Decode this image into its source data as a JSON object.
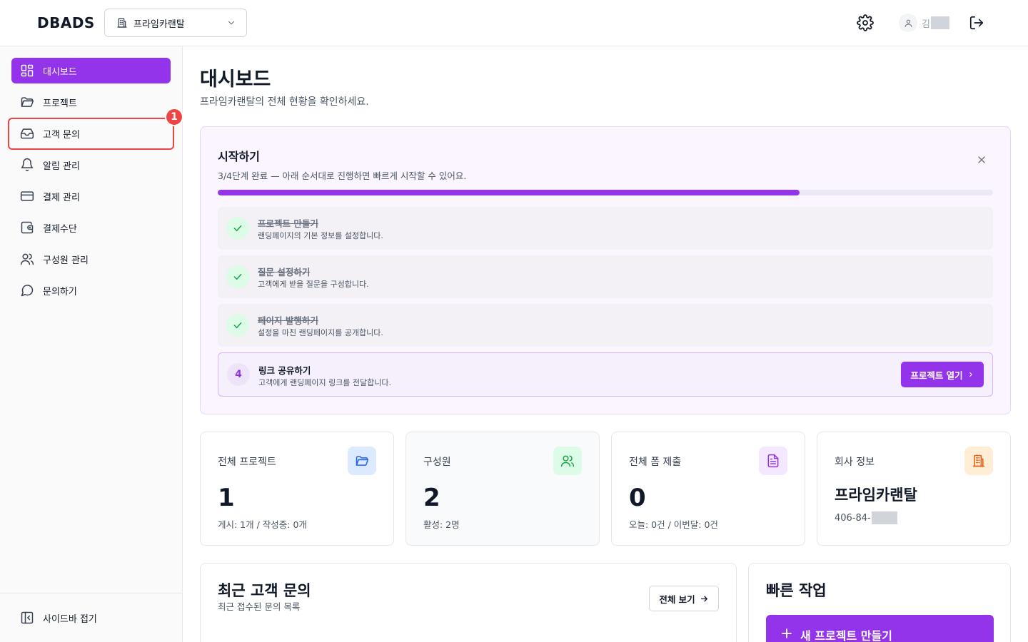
{
  "app": {
    "logo": "DBADS"
  },
  "header": {
    "org_select": {
      "value": "프라임카랜탈",
      "icon": "building-icon",
      "chevron": "chevron-down-icon"
    },
    "settings_icon": "gear-icon",
    "user": {
      "name": "김"
    },
    "logout_icon": "logout-icon"
  },
  "sidebar": {
    "items": [
      {
        "label": "대시보드",
        "icon": "dashboard-icon",
        "active": true
      },
      {
        "label": "프로젝트",
        "icon": "folder-icon"
      },
      {
        "label": "고객 문의",
        "icon": "inbox-icon"
      },
      {
        "label": "알림 관리",
        "icon": "bell-icon"
      },
      {
        "label": "결제 관리",
        "icon": "credit-card-icon"
      },
      {
        "label": "결제수단",
        "icon": "wallet-icon"
      },
      {
        "label": "구성원 관리",
        "icon": "users-icon"
      },
      {
        "label": "문의하기",
        "icon": "message-icon"
      }
    ],
    "highlight_badge": "1",
    "collapse_label": "사이드바 접기"
  },
  "main": {
    "title": "대시보드",
    "subtitle": "프라임카랜탈의 전체 현황을 확인하세요.",
    "getting_started": {
      "title": "시작하기",
      "subtitle": "3/4단계 완료 — 아래 순서대로 진행하면 빠르게 시작할 수 있어요.",
      "progress": 0.75,
      "steps": [
        {
          "title": "프로젝트 만들기",
          "desc": "랜딩페이지의 기본 정보를 설정합니다.",
          "done": true
        },
        {
          "title": "질문 설정하기",
          "desc": "고객에게 받을 질문을 구성합니다.",
          "done": true
        },
        {
          "title": "페이지 발행하기",
          "desc": "설정을 마친 랜딩페이지를 공개합니다.",
          "done": true
        },
        {
          "number": "4",
          "title": "링크 공유하기",
          "desc": "고객에게 랜딩페이지 링크를 전달합니다.",
          "done": false,
          "button": "프로젝트 열기"
        }
      ]
    },
    "stats": [
      {
        "label": "전체 프로젝트",
        "value": "1",
        "sub": "게시: 1개 / 작성중: 0개",
        "icon": "folder-icon",
        "icon_bg": "#dbeafe",
        "icon_color": "#2563eb"
      },
      {
        "label": "구성원",
        "value": "2",
        "sub": "활성: 2명",
        "icon": "users-icon",
        "icon_bg": "#dcfce7",
        "icon_color": "#16a34a"
      },
      {
        "label": "전체 폼 제출",
        "value": "0",
        "sub": "오늘: 0건 / 이번달: 0건",
        "icon": "document-icon",
        "icon_bg": "#f3e8ff",
        "icon_color": "#9333ea"
      },
      {
        "label": "회사 정보",
        "company": "프라임카랜탈",
        "biz_no": "406-84-",
        "icon": "building-icon",
        "icon_bg": "#ffedd5",
        "icon_color": "#ea580c"
      }
    ],
    "recent": {
      "title": "최근 고객 문의",
      "subtitle": "최근 접수된 문의 목록",
      "view_all": "전체 보기"
    },
    "quick": {
      "title": "빠른 작업",
      "new_project": "새 프로젝트 만들기"
    }
  },
  "colors": {
    "accent": "#9333ea",
    "highlight": "#ef4444",
    "success": "#16a34a"
  }
}
